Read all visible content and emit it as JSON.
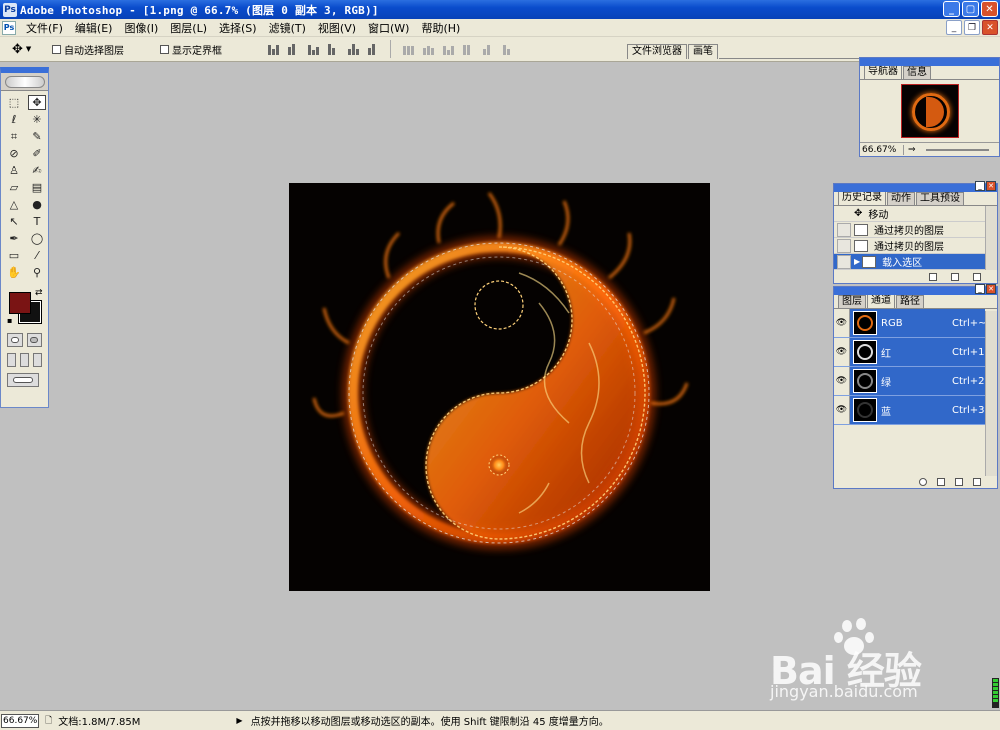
{
  "window": {
    "title": "Adobe Photoshop - [1.png @ 66.7% (图层 0 副本 3, RGB)]",
    "buttons": [
      "minimize",
      "maximize",
      "close"
    ]
  },
  "menu": {
    "items": [
      "文件(F)",
      "编辑(E)",
      "图像(I)",
      "图层(L)",
      "选择(S)",
      "滤镜(T)",
      "视图(V)",
      "窗口(W)",
      "帮助(H)"
    ]
  },
  "options": {
    "auto_select_label": "自动选择图层",
    "show_bounds_label": "显示定界框",
    "palette_well_tabs": [
      "文件浏览器",
      "画笔"
    ]
  },
  "toolbox": {
    "tools": [
      {
        "name": "marquee-tool",
        "glyph": "⬚"
      },
      {
        "name": "move-tool",
        "glyph": "✥"
      },
      {
        "name": "lasso-tool",
        "glyph": "ℓ"
      },
      {
        "name": "magic-wand-tool",
        "glyph": "✳"
      },
      {
        "name": "crop-tool",
        "glyph": "⌗"
      },
      {
        "name": "slice-tool",
        "glyph": "✎"
      },
      {
        "name": "healing-brush-tool",
        "glyph": "⊘"
      },
      {
        "name": "brush-tool",
        "glyph": "✐"
      },
      {
        "name": "clone-stamp-tool",
        "glyph": "♙"
      },
      {
        "name": "history-brush-tool",
        "glyph": "✍"
      },
      {
        "name": "eraser-tool",
        "glyph": "▱"
      },
      {
        "name": "gradient-tool",
        "glyph": "▤"
      },
      {
        "name": "blur-tool",
        "glyph": "△"
      },
      {
        "name": "dodge-tool",
        "glyph": "●"
      },
      {
        "name": "path-selection-tool",
        "glyph": "↖"
      },
      {
        "name": "type-tool",
        "glyph": "T"
      },
      {
        "name": "pen-tool",
        "glyph": "✒"
      },
      {
        "name": "shape-tool",
        "glyph": "◯"
      },
      {
        "name": "notes-tool",
        "glyph": "▭"
      },
      {
        "name": "eyedropper-tool",
        "glyph": "⁄"
      },
      {
        "name": "hand-tool",
        "glyph": "✋"
      },
      {
        "name": "zoom-tool",
        "glyph": "⚲"
      }
    ],
    "foreground_color": "#7a1414",
    "background_color": "#111111"
  },
  "navigator": {
    "tabs": [
      "导航器",
      "信息"
    ],
    "zoom": "66.67%"
  },
  "history": {
    "tabs": [
      "历史记录",
      "动作",
      "工具预设"
    ],
    "items": [
      {
        "label": "移动",
        "selected": false
      },
      {
        "label": "通过拷贝的图层",
        "selected": false
      },
      {
        "label": "通过拷贝的图层",
        "selected": false
      },
      {
        "label": "载入选区",
        "selected": true
      }
    ]
  },
  "channels": {
    "tabs": [
      "图层",
      "通道",
      "路径"
    ],
    "items": [
      {
        "name": "RGB",
        "shortcut": "Ctrl+~",
        "tint": "#e06a12"
      },
      {
        "name": "红",
        "shortcut": "Ctrl+1",
        "tint": "#dddddd"
      },
      {
        "name": "绿",
        "shortcut": "Ctrl+2",
        "tint": "#888888"
      },
      {
        "name": "蓝",
        "shortcut": "Ctrl+3",
        "tint": "#333333"
      }
    ]
  },
  "status": {
    "zoom": "66.67%",
    "doc": "文档:1.8M/7.85M",
    "hint": "点按并拖移以移动图层或移动选区的副本。使用 Shift 键限制沿 45 度增量方向。"
  },
  "watermark": {
    "brand": "Bai 经验",
    "url": "jingyan.baidu.com"
  },
  "colors": {
    "xp_blue": "#0a4ccc",
    "selection_blue": "#3168c9",
    "fire": "#ff7a10"
  }
}
